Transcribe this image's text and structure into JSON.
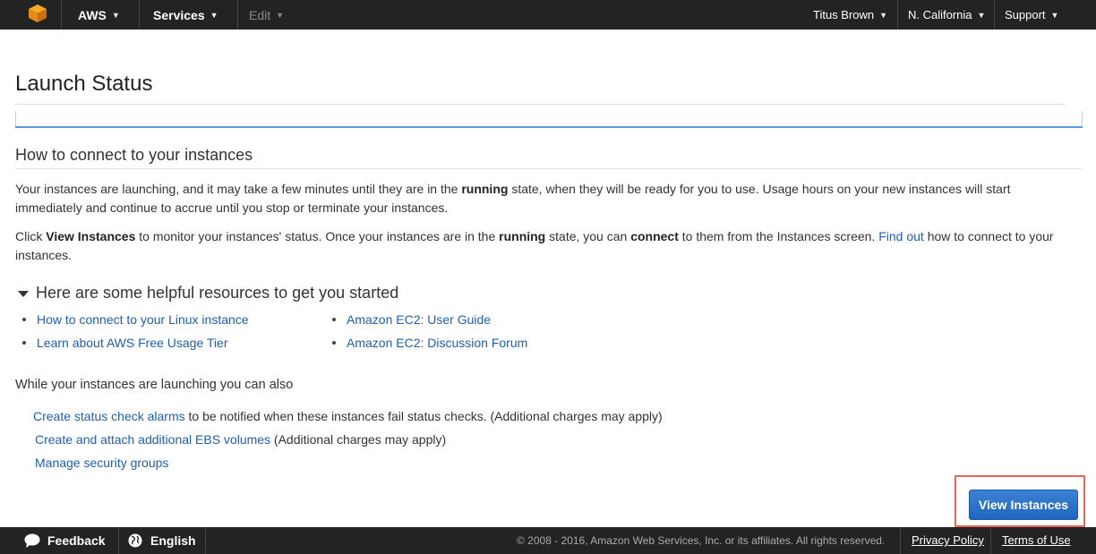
{
  "nav": {
    "aws_label": "AWS",
    "services_label": "Services",
    "edit_label": "Edit",
    "user_label": "Titus Brown",
    "region_label": "N. California",
    "support_label": "Support",
    "caret": "▼"
  },
  "page": {
    "title": "Launch Status"
  },
  "connect": {
    "heading": "How to connect to your instances",
    "p1_a": "Your instances are launching, and it may take a few minutes until they are in the ",
    "p1_b": "running",
    "p1_c": " state, when they will be ready for you to use. Usage hours on your new instances will start immediately and continue to accrue until you stop or terminate your instances.",
    "p2_a": "Click ",
    "p2_b": "View Instances",
    "p2_c": " to monitor your instances' status. Once your instances are in the ",
    "p2_d": "running",
    "p2_e": " state, you can ",
    "p2_f": "connect",
    "p2_g": " to them from the Instances screen. ",
    "p2_link": "Find out",
    "p2_h": " how to connect to your instances."
  },
  "resources": {
    "heading": "Here are some helpful resources to get you started",
    "left": [
      {
        "label": "How to connect to your Linux instance"
      },
      {
        "label": "Learn about AWS Free Usage Tier"
      }
    ],
    "right": [
      {
        "label": "Amazon EC2: User Guide"
      },
      {
        "label": "Amazon EC2: Discussion Forum"
      }
    ]
  },
  "also": {
    "heading": "While your instances are launching you can also",
    "items": [
      {
        "link": "Create status check alarms",
        "text": " to be notified when these instances fail status checks. (Additional charges may apply)"
      },
      {
        "link": "Create and attach additional EBS volumes",
        "text": " (Additional charges may apply)"
      },
      {
        "link": "Manage security groups",
        "text": ""
      }
    ]
  },
  "actions": {
    "view_instances": "View Instances"
  },
  "footer": {
    "feedback": "Feedback",
    "language": "English",
    "copyright": "© 2008 - 2016, Amazon Web Services, Inc. or its affiliates. All rights reserved.",
    "privacy": "Privacy Policy",
    "terms": "Terms of Use"
  },
  "colors": {
    "link": "#1f5fae",
    "nav_bg": "#232323",
    "button": "#2a72c8",
    "highlight": "#e8645a"
  }
}
